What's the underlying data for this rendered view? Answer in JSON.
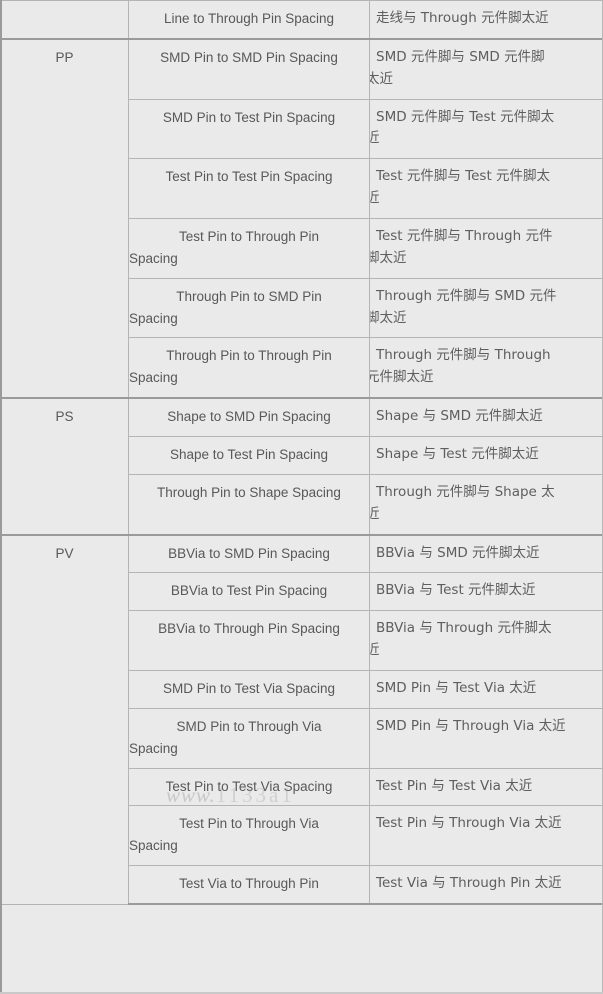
{
  "document": {
    "kind": "scanned-reference-table",
    "watermark": "www.",
    "watermark_suffix": "1133a1"
  },
  "table": {
    "groups": [
      {
        "code": "",
        "rows": [
          {
            "en": "Line to Through Pin Spacing",
            "en_lines": [
              "Line to Through Pin Spacing"
            ],
            "cn": "走线与 Through 元件脚太近",
            "cn_lines": [
              "走线与 Through 元件脚太近"
            ]
          }
        ]
      },
      {
        "code": "PP",
        "rows": [
          {
            "en": "SMD Pin to SMD Pin Spacing",
            "en_lines": [
              "SMD Pin to SMD Pin Spacing"
            ],
            "cn": "SMD 元件脚与 SMD 元件脚太近",
            "cn_lines": [
              "SMD 元件脚与 SMD 元件脚",
              "太近"
            ]
          },
          {
            "en": "SMD Pin to Test Pin Spacing",
            "en_lines": [
              "SMD Pin to Test Pin Spacing"
            ],
            "cn": "SMD 元件脚与 Test 元件脚太近",
            "cn_lines": [
              "SMD 元件脚与 Test 元件脚太",
              "近"
            ]
          },
          {
            "en": "Test Pin to Test Pin Spacing",
            "en_lines": [
              "Test Pin to Test Pin Spacing"
            ],
            "cn": "Test 元件脚与 Test 元件脚太近",
            "cn_lines": [
              "Test 元件脚与 Test 元件脚太",
              "近"
            ]
          },
          {
            "en": "Test Pin to Through Pin Spacing",
            "en_lines": [
              "Test Pin to Through Pin",
              "Spacing"
            ],
            "cn": "Test 元件脚与 Through 元件脚太近",
            "cn_lines": [
              "Test 元件脚与 Through 元件",
              "脚太近"
            ]
          },
          {
            "en": "Through Pin to SMD Pin Spacing",
            "en_lines": [
              "Through Pin to SMD Pin",
              "Spacing"
            ],
            "cn": "Through 元件脚与 SMD 元件脚太近",
            "cn_lines": [
              "Through 元件脚与 SMD 元件",
              "脚太近"
            ]
          },
          {
            "en": "Through Pin to Through Pin Spacing",
            "en_lines": [
              "Through Pin to Through Pin",
              "Spacing"
            ],
            "cn": "Through 元件脚与 Through 元件脚太近",
            "cn_lines": [
              "Through 元件脚与 Through",
              "元件脚太近"
            ]
          }
        ]
      },
      {
        "code": "PS",
        "rows": [
          {
            "en": "Shape to SMD Pin Spacing",
            "en_lines": [
              "Shape to SMD Pin Spacing"
            ],
            "cn": "Shape 与 SMD 元件脚太近",
            "cn_lines": [
              "Shape 与 SMD 元件脚太近"
            ]
          },
          {
            "en": "Shape to Test Pin Spacing",
            "en_lines": [
              "Shape to Test Pin Spacing"
            ],
            "cn": "Shape 与 Test 元件脚太近",
            "cn_lines": [
              "Shape 与 Test 元件脚太近"
            ]
          },
          {
            "en": "Through Pin to Shape Spacing",
            "en_lines": [
              "Through Pin to Shape Spacing"
            ],
            "cn": "Through 元件脚与 Shape 太近",
            "cn_lines": [
              "Through 元件脚与 Shape 太",
              "近"
            ]
          }
        ]
      },
      {
        "code": "PV",
        "rows": [
          {
            "en": "BBVia to SMD Pin Spacing",
            "en_lines": [
              "BBVia to SMD Pin Spacing"
            ],
            "cn": "BBVia 与 SMD 元件脚太近",
            "cn_lines": [
              "BBVia 与 SMD 元件脚太近"
            ]
          },
          {
            "en": "BBVia to Test Pin Spacing",
            "en_lines": [
              "BBVia to Test Pin Spacing"
            ],
            "cn": "BBVia 与 Test 元件脚太近",
            "cn_lines": [
              "BBVia 与 Test 元件脚太近"
            ]
          },
          {
            "en": "BBVia to Through Pin Spacing",
            "en_lines": [
              "BBVia to Through Pin Spacing"
            ],
            "cn": "BBVia 与 Through 元件脚太近",
            "cn_lines": [
              "BBVia 与 Through 元件脚太",
              "近"
            ]
          },
          {
            "en": "SMD Pin to Test Via Spacing",
            "en_lines": [
              "SMD Pin to Test Via Spacing"
            ],
            "cn": "SMD Pin 与 Test Via 太近",
            "cn_lines": [
              "SMD Pin 与 Test Via 太近"
            ]
          },
          {
            "en": "SMD Pin to Through Via Spacing",
            "en_lines": [
              "SMD Pin to Through Via",
              "Spacing"
            ],
            "cn": "SMD Pin 与 Through Via 太近",
            "cn_lines": [
              "SMD Pin 与 Through Via 太近"
            ]
          },
          {
            "en": "Test Pin to Test Via Spacing",
            "en_lines": [
              "Test Pin to Test Via Spacing"
            ],
            "cn": "Test Pin 与 Test Via 太近",
            "cn_lines": [
              "Test Pin 与 Test Via 太近"
            ]
          },
          {
            "en": "Test Pin to Through Via Spacing",
            "en_lines": [
              "Test Pin to Through Via",
              "Spacing"
            ],
            "cn": "Test Pin 与 Through Via 太近",
            "cn_lines": [
              "Test Pin 与 Through Via 太近"
            ]
          },
          {
            "en": "Test Via to Through Pin",
            "en_lines": [
              "Test Via to Through Pin"
            ],
            "cn": "Test Via 与 Through Pin 太近",
            "cn_lines": [
              "Test Via 与 Through Pin 太近"
            ]
          }
        ]
      }
    ]
  },
  "colors": {
    "page_background": "#eaeaea",
    "cell_border": "#b4b4b4",
    "group_border": "#9a9a9a",
    "text": "#58585a"
  }
}
